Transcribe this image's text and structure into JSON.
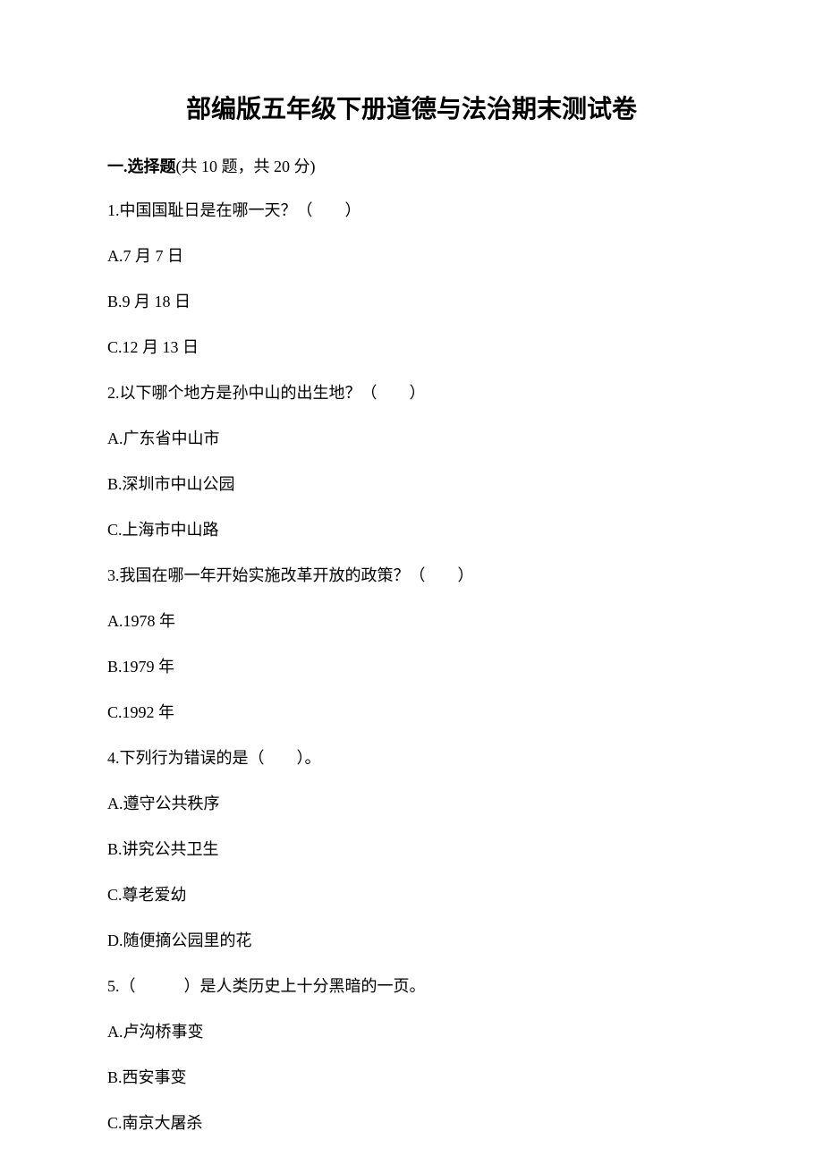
{
  "title": "部编版五年级下册道德与法治期末测试卷",
  "section": {
    "num": "一.",
    "name": "选择题",
    "info": "(共 10 题，共 20 分)"
  },
  "questions": [
    {
      "num": "1.",
      "text": "中国国耻日是在哪一天？（　　）",
      "options": [
        {
          "label": "A.",
          "text": "7 月 7 日"
        },
        {
          "label": "B.",
          "text": "9 月 18 日"
        },
        {
          "label": "C.",
          "text": "12 月 13 日"
        }
      ]
    },
    {
      "num": "2.",
      "text": "以下哪个地方是孙中山的出生地？（　　）",
      "options": [
        {
          "label": "A.",
          "text": "广东省中山市"
        },
        {
          "label": "B.",
          "text": "深圳市中山公园"
        },
        {
          "label": "C.",
          "text": "上海市中山路"
        }
      ]
    },
    {
      "num": "3.",
      "text": "我国在哪一年开始实施改革开放的政策？（　　）",
      "options": [
        {
          "label": "A.",
          "text": "1978 年"
        },
        {
          "label": "B.",
          "text": "1979 年"
        },
        {
          "label": "C.",
          "text": "1992 年"
        }
      ]
    },
    {
      "num": "4.",
      "text": "下列行为错误的是（　　）。",
      "options": [
        {
          "label": "A.",
          "text": "遵守公共秩序"
        },
        {
          "label": "B.",
          "text": "讲究公共卫生"
        },
        {
          "label": "C.",
          "text": "尊老爱幼"
        },
        {
          "label": "D.",
          "text": "随便摘公园里的花"
        }
      ]
    },
    {
      "num": "5.",
      "text": "（　　　）是人类历史上十分黑暗的一页。",
      "options": [
        {
          "label": "A.",
          "text": "卢沟桥事变"
        },
        {
          "label": "B.",
          "text": "西安事变"
        },
        {
          "label": "C.",
          "text": "南京大屠杀"
        }
      ]
    }
  ]
}
